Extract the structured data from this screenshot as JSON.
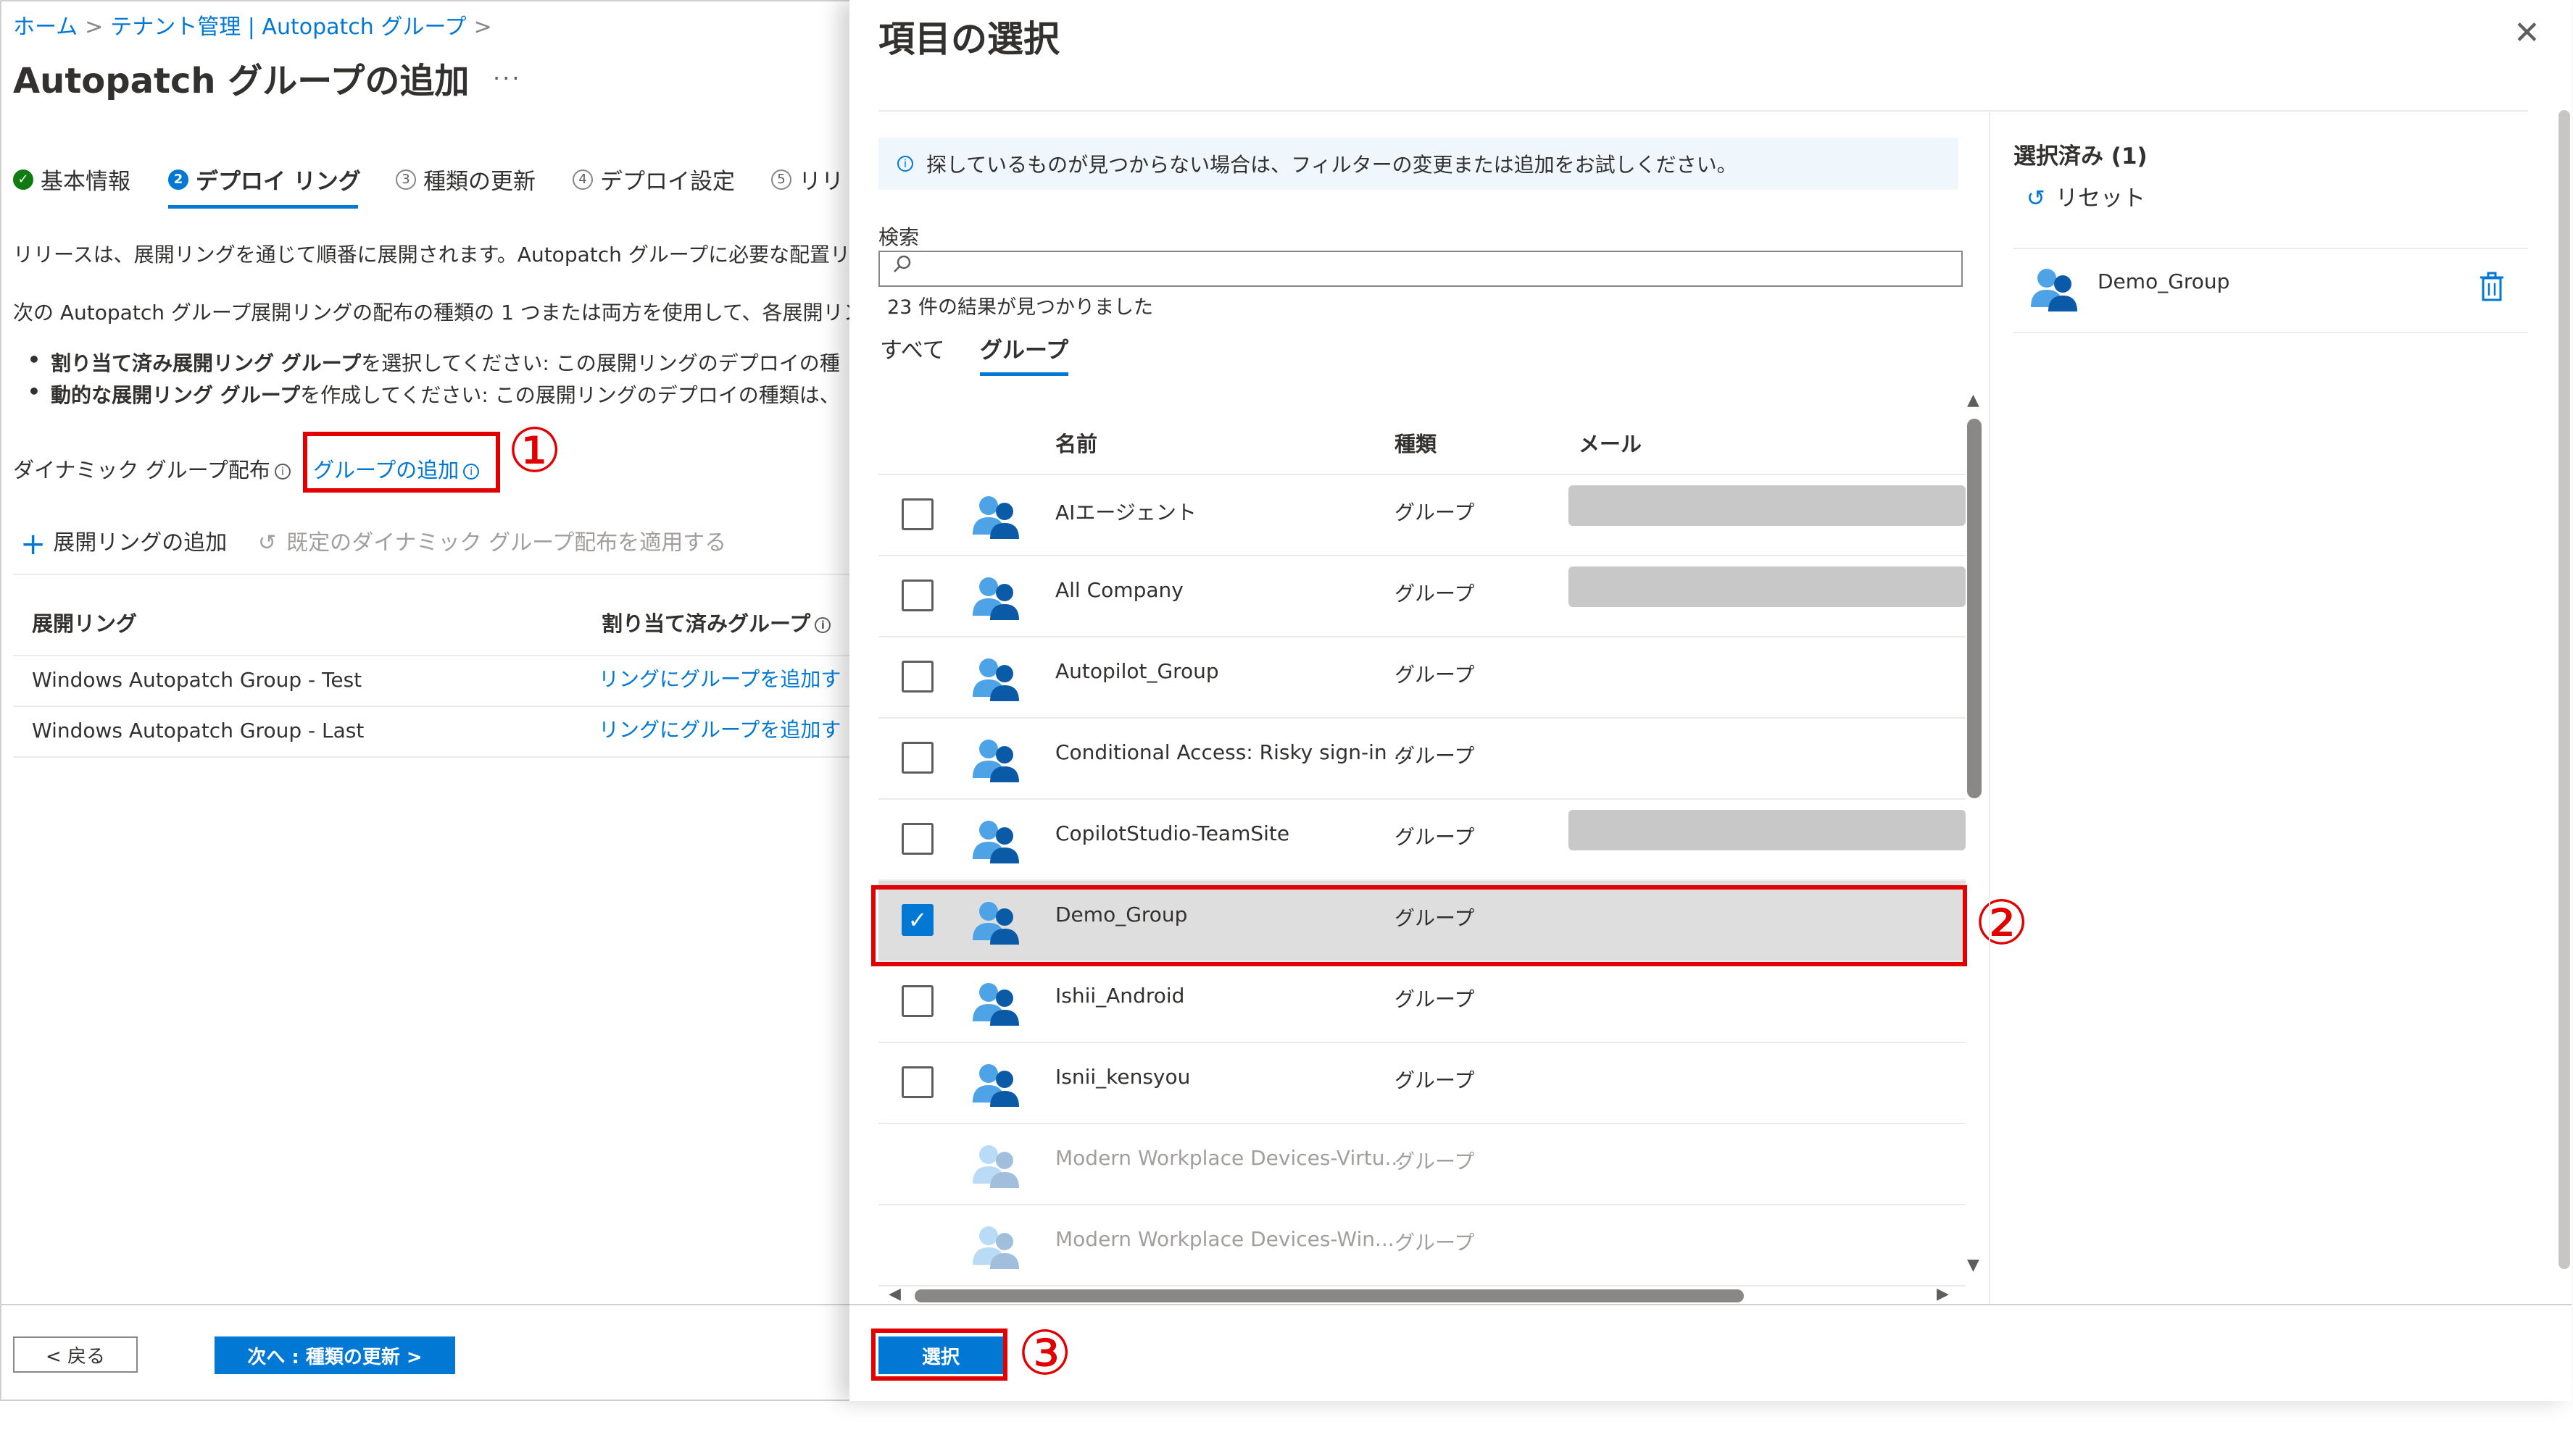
{
  "breadcrumb": {
    "items": [
      "ホーム",
      "テナント管理 | Autopatch グループ"
    ]
  },
  "page": {
    "title": "Autopatch グループの追加",
    "more": "...",
    "steps": [
      {
        "num": "✓",
        "label": "基本情報"
      },
      {
        "num": "2",
        "label": "デプロイ リング"
      },
      {
        "num": "3",
        "label": "種類の更新"
      },
      {
        "num": "4",
        "label": "デプロイ設定"
      },
      {
        "num": "5",
        "label": "リリ"
      }
    ],
    "intro": "リリースは、展開リングを通じて順番に展開されます。Autopatch グループに必要な配置リン",
    "intro2": "次の Autopatch グループ展開リングの配布の種類の 1 つまたは両方を使用して、各展開リング",
    "bullet1_bold": "割り当て済み展開リング グループ",
    "bullet1_rest": "を選択してください: この展開リングのデプロイの種",
    "bullet2_bold": "動的な展開リング グループ",
    "bullet2_rest": "を作成してください: この展開リングのデプロイの種類は、",
    "dynamic_label": "ダイナミック グループ配布",
    "add_group_link": "グループの追加",
    "callout1": "①",
    "cmd_add_ring": "展開リングの追加",
    "cmd_apply_default": "既定のダイナミック グループ配布を適用する",
    "table": {
      "headers": [
        "展開リング",
        "割り当て済みグループ"
      ],
      "rows": [
        {
          "ring": "Windows Autopatch Group - Test",
          "action": "リングにグループを追加す"
        },
        {
          "ring": "Windows Autopatch Group - Last",
          "action": "リングにグループを追加す"
        }
      ]
    },
    "back_button": "< 戻る",
    "next_button": "次へ : 種類の更新 >"
  },
  "panel": {
    "title": "項目の選択",
    "close": "✕",
    "info": "探しているものが見つからない場合は、フィルターの変更または追加をお試しください。",
    "search_label": "検索",
    "result_count": "23 件の結果が見つかりました",
    "tabs": [
      "すべて",
      "グループ"
    ],
    "columns": [
      "名前",
      "種類",
      "メール"
    ],
    "rows": [
      {
        "name": "AIエージェント",
        "type": "グループ",
        "checked": false,
        "redacted": true,
        "faded": false
      },
      {
        "name": "All Company",
        "type": "グループ",
        "checked": false,
        "redacted": true,
        "faded": false
      },
      {
        "name": "Autopilot_Group",
        "type": "グループ",
        "checked": false,
        "redacted": false,
        "faded": false
      },
      {
        "name": "Conditional Access: Risky sign-in ...",
        "type": "グループ",
        "checked": false,
        "redacted": false,
        "faded": false
      },
      {
        "name": "CopilotStudio-TeamSite",
        "type": "グループ",
        "checked": false,
        "redacted": true,
        "faded": false
      },
      {
        "name": "Demo_Group",
        "type": "グループ",
        "checked": true,
        "redacted": false,
        "faded": false
      },
      {
        "name": "Ishii_Android",
        "type": "グループ",
        "checked": false,
        "redacted": false,
        "faded": false
      },
      {
        "name": "Isnii_kensyou",
        "type": "グループ",
        "checked": false,
        "redacted": false,
        "faded": false
      },
      {
        "name": "Modern Workplace Devices-Virtu...",
        "type": "グループ",
        "checked": false,
        "redacted": false,
        "faded": true
      },
      {
        "name": "Modern Workplace Devices-Win...",
        "type": "グループ",
        "checked": false,
        "redacted": false,
        "faded": true
      }
    ],
    "callout2": "②",
    "select_button": "選択",
    "callout3": "③",
    "selected_title": "選択済み (1)",
    "reset": "リセット",
    "selected_items": [
      "Demo_Group"
    ]
  },
  "colors": {
    "accent": "#0078d4",
    "highlight": "#e00000",
    "success": "#107c10"
  },
  "icons": [
    "chevron-right-icon",
    "info-icon",
    "plus-icon",
    "undo-icon",
    "search-icon",
    "group-icon",
    "delete-icon",
    "close-icon",
    "check-icon"
  ]
}
